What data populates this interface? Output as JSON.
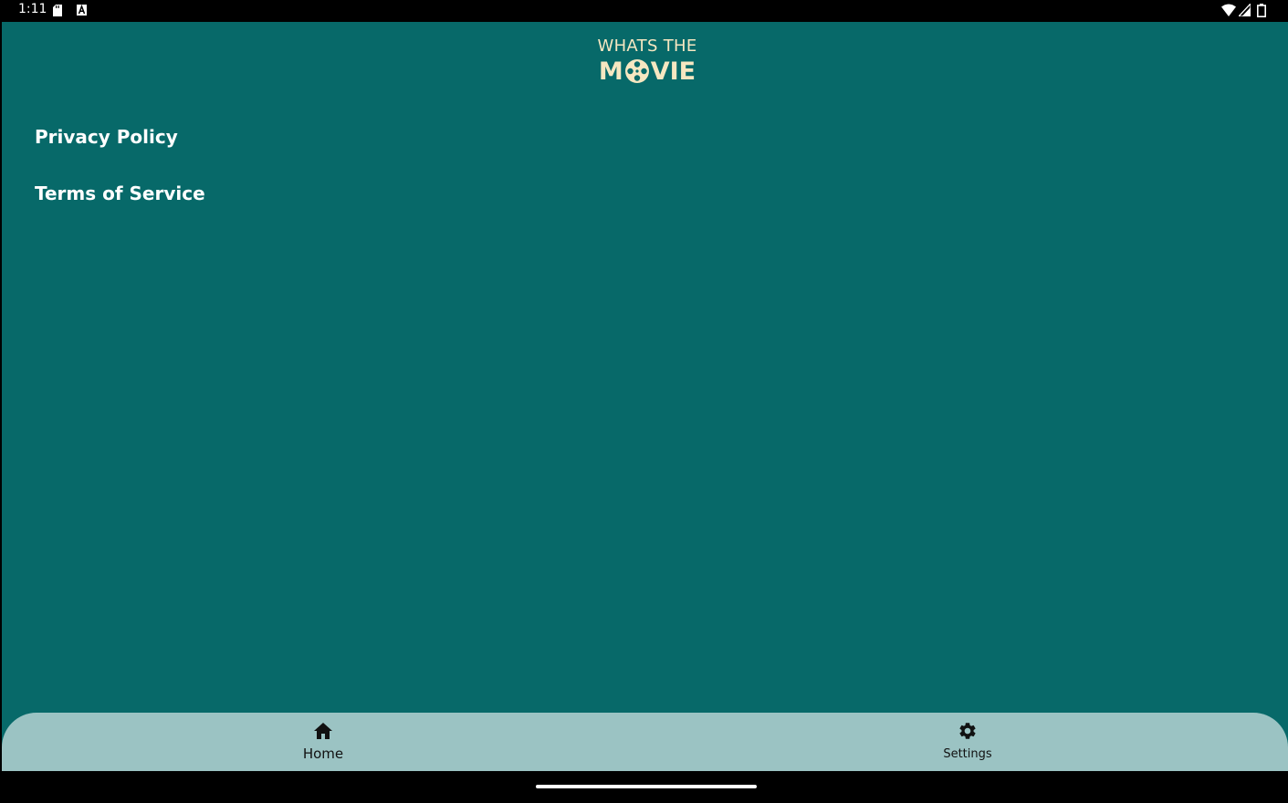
{
  "status_bar": {
    "time": "1:11",
    "icons": [
      "sd-card-icon",
      "keyboard-a-icon",
      "wifi-icon",
      "signal-icon",
      "battery-icon"
    ]
  },
  "logo": {
    "line1": "WHATS THE",
    "line2_prefix": "M",
    "line2_suffix": "VIE"
  },
  "menu": {
    "privacy_policy": "Privacy Policy",
    "terms_of_service": "Terms of Service"
  },
  "bottom_nav": {
    "home_label": "Home",
    "settings_label": "Settings"
  },
  "colors": {
    "background": "#076969",
    "logo_cream": "#f6e7c1",
    "nav_bar": "#9bc3c3",
    "link_text": "#ffffff"
  }
}
